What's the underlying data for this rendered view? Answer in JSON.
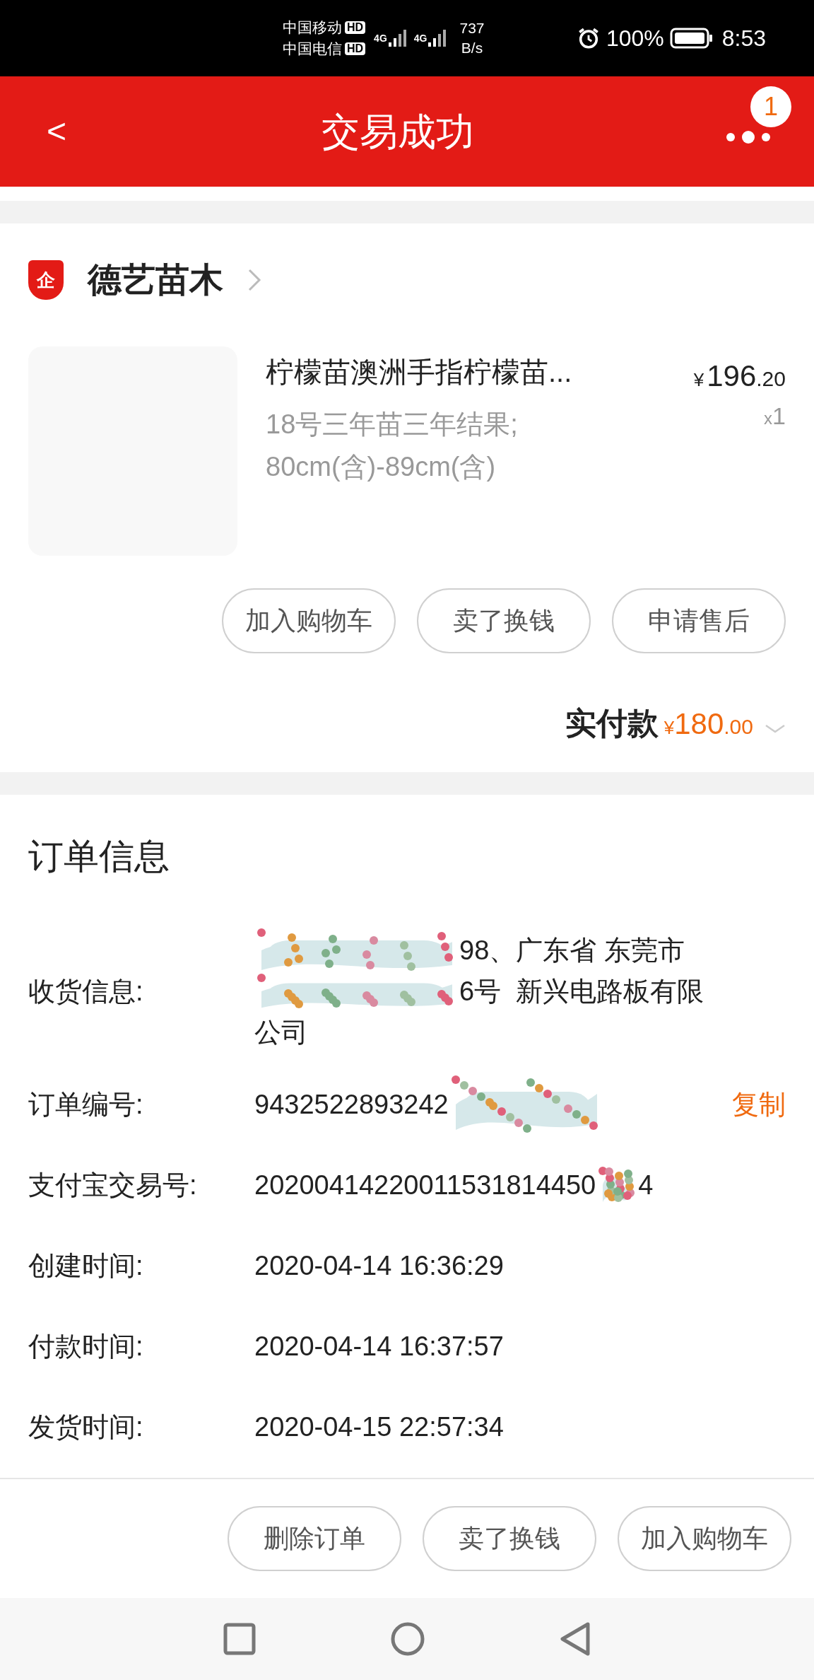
{
  "status_bar": {
    "carrier_1": "中国移动",
    "carrier_2": "中国电信",
    "hd_badges": [
      "HD",
      "HD"
    ],
    "network_1": "4G",
    "network_2": "4G",
    "speed_value": "737",
    "speed_unit": "B/s",
    "battery": "100%",
    "time": "8:53"
  },
  "header": {
    "title": "交易成功",
    "back": "<",
    "notification_count": "1"
  },
  "shop": {
    "name": "德艺苗木",
    "badge": "企"
  },
  "product": {
    "title": "柠檬苗澳洲手指柠檬苗...",
    "specs": "18号三年苗三年结果;\n80cm(含)-89cm(含)",
    "price_symbol": "¥",
    "price_int": "196",
    "price_dec": ".20",
    "qty_prefix": "x",
    "qty": "1",
    "actions": [
      "加入购物车",
      "卖了换钱",
      "申请售后"
    ]
  },
  "payment": {
    "label": "实付款",
    "symbol": "¥",
    "int": "180",
    "dec": ".00"
  },
  "order_info": {
    "title": "订单信息",
    "rows": [
      {
        "kind": "address",
        "label": "收货信息:",
        "lines": [
          "98、广东省 东莞市",
          "6号  新兴电路板有限",
          "公司"
        ]
      },
      {
        "kind": "copy",
        "label": "订单编号:",
        "value": "9432522893242",
        "action": "复制"
      },
      {
        "kind": "redacted",
        "label": "支付宝交易号:",
        "value": "20200414220011531814450",
        "tail": "4"
      },
      {
        "kind": "plain",
        "label": "创建时间:",
        "value": "2020-04-14 16:36:29"
      },
      {
        "kind": "plain",
        "label": "付款时间:",
        "value": "2020-04-14 16:37:57"
      },
      {
        "kind": "plain",
        "label": "发货时间:",
        "value": "2020-04-15 22:57:34"
      }
    ]
  },
  "footer_actions": [
    "删除订单",
    "卖了换钱",
    "加入购物车"
  ]
}
